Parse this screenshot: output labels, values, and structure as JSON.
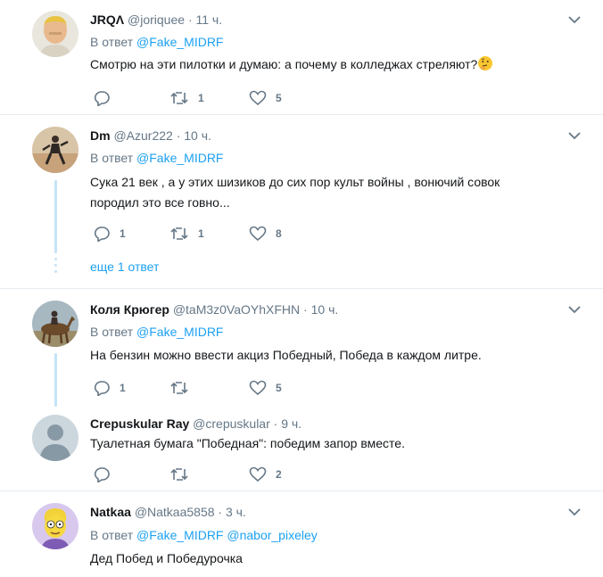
{
  "colors": {
    "link": "#1da1f2",
    "muted": "#657786",
    "thread": "#c4e3f7",
    "text": "#14171a"
  },
  "tweets": [
    {
      "name": "JRQΛ",
      "handle": "@joriquee",
      "dot": "·",
      "time": "11 ч.",
      "reply_prefix": "В ответ",
      "mentions": [
        "@Fake_MIDRF"
      ],
      "text": "Смотрю на эти пилотки и думаю: а почему в колледжах стреляют?",
      "emoji": "thinking-face-emoji",
      "reply_count": "",
      "retweet_count": "1",
      "like_count": "5"
    },
    {
      "name": "Dm",
      "handle": "@Azur222",
      "dot": "·",
      "time": "10 ч.",
      "reply_prefix": "В ответ",
      "mentions": [
        "@Fake_MIDRF"
      ],
      "text_line1": "Сука 21 век , а у этих шизиков до сих пор культ войны , вонючий совок",
      "text_line2": "породил это все говно...",
      "reply_count": "1",
      "retweet_count": "1",
      "like_count": "8",
      "more_replies": "еще 1 ответ"
    },
    {
      "name": "Коля Крюгер",
      "handle": "@taM3z0VaOYhXFHN",
      "dot": "·",
      "time": "10 ч.",
      "reply_prefix": "В ответ",
      "mentions": [
        "@Fake_MIDRF"
      ],
      "text": "На бензин можно ввести акциз Победный, Победа в каждом литре.",
      "reply_count": "1",
      "retweet_count": "",
      "like_count": "5"
    },
    {
      "name": "Crepuskular Ray",
      "handle": "@crepuskular",
      "dot": "·",
      "time": "9 ч.",
      "text": "Туалетная бумага \"Победная\": победим запор вместе.",
      "reply_count": "",
      "retweet_count": "",
      "like_count": "2"
    },
    {
      "name": "Natkaa",
      "handle": "@Natkaa5858",
      "dot": "·",
      "time": "3 ч.",
      "reply_prefix": "В ответ",
      "mentions": [
        "@Fake_MIDRF",
        "@nabor_pixeley"
      ],
      "text": "Дед Побед и Победурочка"
    }
  ]
}
